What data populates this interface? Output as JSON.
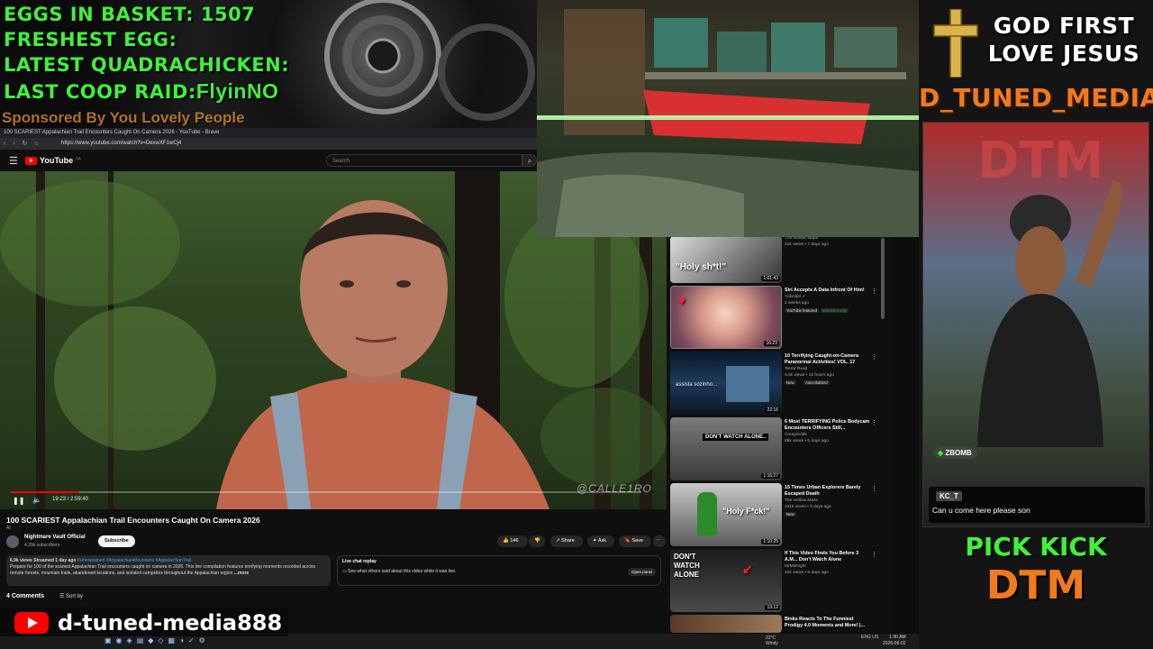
{
  "overlay_stats": [
    {
      "label": "EGGS IN BASKET: ",
      "value": "1507"
    },
    {
      "label": "FRESHEST EGG:",
      "value": ""
    },
    {
      "label": "LATEST QUADRACHICKEN:",
      "value": ""
    },
    {
      "label": "LAST COOP RAID:",
      "value": "FlyinNO"
    }
  ],
  "sponsor_text": "Sponsored By You Lovely People",
  "browser": {
    "tab_title": "100 SCARIEST Appalachian Trail Encounters Caught On Camera 2026 - YouTube - Brave",
    "url": "https://www.youtube.com/watch?v=DexwXF1wCj4"
  },
  "youtube": {
    "logo_text": "YouTube",
    "logo_country": "CA",
    "search_placeholder": "Search",
    "video": {
      "current_time": "19:23",
      "duration": "2:59:40",
      "progress_fraction": 0.108,
      "watermark": "@CALLE1RO",
      "title": "100 SCARIEST Appalachian Trail Encounters Caught On Camera 2026",
      "ai_label": "AI"
    },
    "channel": {
      "name": "Nightmare Vault Official",
      "subscribers": "4.39k subscribers",
      "subscribe_label": "Subscribe"
    },
    "actions": {
      "likes": "146",
      "share": "Share",
      "ask": "Ask",
      "save": "Save",
      "more": "⋯"
    },
    "description": {
      "meta": "6.9k views  Streamed 1 day ago",
      "tags": "#Unexplained #AppalachianMountains #AppalachianTrail",
      "text": "Prepare for 100 of the scariest Appalachian Trail encounters caught on camera in 2026. This live compilation features terrifying moments recorded across remote forests, mountain trails, abandoned locations, and isolated campsites throughout the Appalachian region",
      "more": "...more"
    },
    "chat_replay": {
      "title": "Live chat replay",
      "text": "See what others said about this video while it was live.",
      "button": "Open panel"
    },
    "comments_count": "4 Comments",
    "sort_label": "Sort by"
  },
  "recommendations": [
    {
      "title": "",
      "channel": "The Hollow Maps",
      "meta": "21k views • 7 days ago",
      "duration": "1:01:43",
      "caption": "\"Holy sh*t!\"",
      "badge": "",
      "top_only": true
    },
    {
      "title": "Siri Accepts A Data Infront Of Him!",
      "channel": "Yukeldel ✓",
      "meta": "2 weeks ago",
      "duration": "16:23",
      "caption": "",
      "badge": "YouTube featured",
      "badge2": "Members only"
    },
    {
      "title": "10 Terrifying Caught-on-Camera Paranormal Activities! VOL. 17",
      "channel": "Terror Read",
      "meta": "3.6k views • 12 hours ago",
      "duration": "22:16",
      "caption": "assista sozinho...",
      "badge": "New",
      "badge2": "Auto-dubbed"
    },
    {
      "title": "6 Most TERRIFYING Police Bodycam Encounters Officers Still...",
      "channel": "CreepsVids",
      "meta": "89k views • 6 days ago",
      "duration": "1:16:27",
      "caption": "DON'T WATCH ALONE..",
      "badge": ""
    },
    {
      "title": "15 Times Urban Explorers Barely Escaped Death",
      "channel": "The Hollow Maze",
      "meta": "131k views • 5 days ago",
      "duration": "1:10:25",
      "caption": "\"Holy F*ck!\"",
      "badge": "New"
    },
    {
      "title": "If This Video Finds You Before 3 A.M... Don't Watch Alone",
      "channel": "MrMidnight",
      "meta": "42k views • 6 days ago",
      "duration": "13:12",
      "caption": "DON'T WATCH ALONE",
      "badge": ""
    },
    {
      "title": "Binks Reacts To The Funniest Prodigy 4.0 Moments and More! |...",
      "channel": "",
      "meta": "",
      "duration": "",
      "caption": "",
      "badge": ""
    }
  ],
  "right_column": {
    "line1": "GOD FIRST",
    "line2": "LOVE JESUS",
    "brand": "D_TUNED_MEDIA",
    "chat_user1": "ZBOMB",
    "chat_user2": "KC_T",
    "chat_message": "Can u come here please son",
    "kick_line1": "PICK KICK",
    "kick_line2": "DTM",
    "cam_sign": "DTM"
  },
  "handle": {
    "text": "d-tuned-media888"
  },
  "taskbar": {
    "weather_temp": "22°C",
    "weather_desc": "Windy",
    "lang": "ENG US",
    "time": "1:30 AM",
    "date": "2026-06-02"
  },
  "colors": {
    "stat_green": "#3ef23a",
    "brand_orange": "#f07a1c",
    "yt_red": "#ff0000",
    "sponsor_orange": "#d88a2c"
  }
}
